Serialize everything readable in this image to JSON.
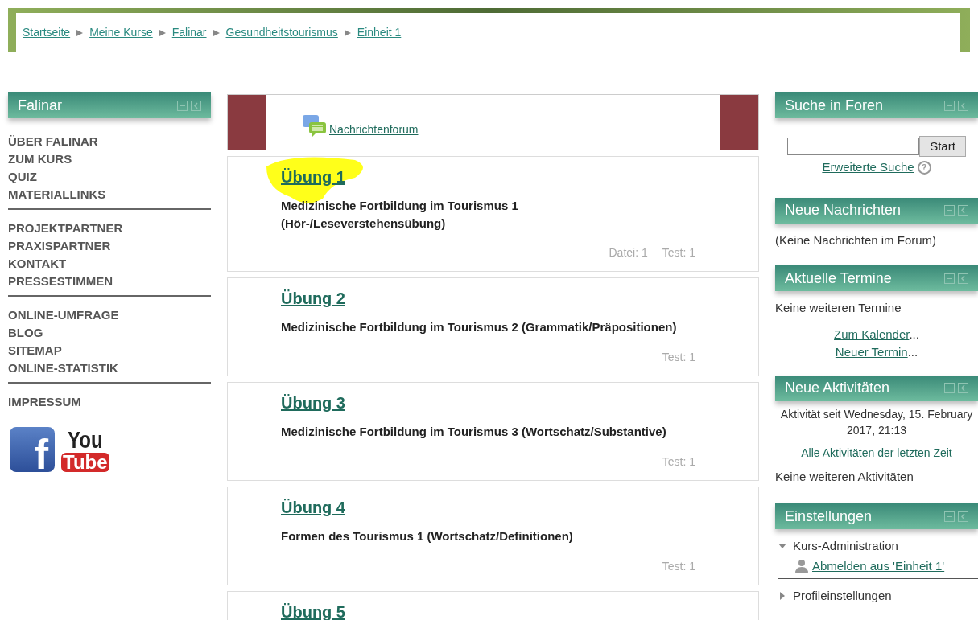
{
  "breadcrumb": [
    "Startseite",
    "Meine Kurse",
    "Falinar",
    "Gesundheitstourismus",
    "Einheit 1"
  ],
  "left_block": {
    "title": "Falinar",
    "groups": [
      [
        "ÜBER FALINAR",
        "ZUM KURS",
        "QUIZ",
        "MATERIALLINKS"
      ],
      [
        "PROJEKTPARTNER",
        "PRAXISPARTNER",
        "KONTAKT",
        "PRESSESTIMMEN"
      ],
      [
        "ONLINE-UMFRAGE",
        "BLOG",
        "SITEMAP",
        "ONLINE-STATISTIK"
      ],
      [
        "IMPRESSUM"
      ]
    ],
    "youtube": [
      "You",
      "Tube"
    ],
    "facebook": "f"
  },
  "forum_link": "Nachrichtenforum",
  "sections": [
    {
      "title": "Übung 1",
      "highlighted": true,
      "description": [
        "Medizinische Fortbildung im Tourismus 1",
        "(Hör-/Leseverstehensübung)"
      ],
      "meta": [
        "Datei: 1",
        "Test: 1"
      ]
    },
    {
      "title": "Übung 2",
      "highlighted": false,
      "description": [
        "Medizinische Fortbildung im Tourismus 2 (Grammatik/Präpositionen)"
      ],
      "meta": [
        "Test: 1"
      ]
    },
    {
      "title": "Übung 3",
      "highlighted": false,
      "description": [
        "Medizinische Fortbildung im Tourismus 3 (Wortschatz/Substantive)"
      ],
      "meta": [
        "Test: 1"
      ]
    },
    {
      "title": "Übung 4",
      "highlighted": false,
      "description": [
        "Formen des Tourismus 1 (Wortschatz/Definitionen)"
      ],
      "meta": [
        "Test: 1"
      ]
    },
    {
      "title": "Übung 5",
      "highlighted": false
    }
  ],
  "search_block": {
    "title": "Suche in Foren",
    "button": "Start",
    "advanced_link": "Erweiterte Suche",
    "help": "?"
  },
  "news_block": {
    "title": "Neue Nachrichten",
    "text": "(Keine Nachrichten im Forum)"
  },
  "events_block": {
    "title": "Aktuelle Termine",
    "text": "Keine weiteren Termine",
    "links": [
      "Zum Kalender",
      "Neuer Termin"
    ],
    "suffix": "..."
  },
  "activity_block": {
    "title": "Neue Aktivitäten",
    "since": "Aktivität seit Wednesday, 15. February 2017, 21:13",
    "link": "Alle Aktivitäten der letzten Zeit",
    "text": "Keine weiteren Aktivitäten"
  },
  "settings_block": {
    "title": "Einstellungen",
    "tree": [
      {
        "label": "Kurs-Administration",
        "expanded": true,
        "children": [
          {
            "label": "Abmelden aus 'Einheit 1'"
          }
        ]
      },
      {
        "label": "Profileinstellungen",
        "expanded": false
      }
    ]
  }
}
